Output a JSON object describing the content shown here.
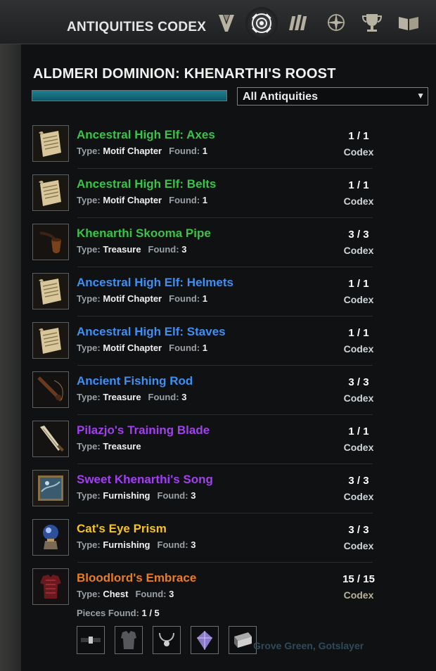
{
  "header": {
    "title": "ANTIQUITIES CODEX",
    "tabs": [
      {
        "icon": "alliance-emblem-icon",
        "active": false
      },
      {
        "icon": "antiquity-lens-icon",
        "active": true
      },
      {
        "icon": "scrolls-icon",
        "active": false
      },
      {
        "icon": "compass-star-icon",
        "active": false
      },
      {
        "icon": "trophy-icon",
        "active": false
      },
      {
        "icon": "open-book-icon",
        "active": false
      }
    ]
  },
  "zone": {
    "title": "ALDMERI DOMINION: KHENARTHI'S ROOST",
    "progress": 1.0,
    "filter": "All Antiquities"
  },
  "colors": {
    "green": "#39c34a",
    "blue": "#3f8ff2",
    "purple": "#a33ff2",
    "gold": "#f5c322",
    "orange": "#ec7c1d",
    "progress": "#1b7c8c"
  },
  "labels": {
    "type": "Type:",
    "found": "Found:",
    "codex": "Codex"
  },
  "items": [
    {
      "name": "Ancestral High Elf: Axes",
      "quality": "green",
      "type": "Motif Chapter",
      "found": "1",
      "count": "1 / 1",
      "icon": "scroll-icon"
    },
    {
      "name": "Ancestral High Elf: Belts",
      "quality": "green",
      "type": "Motif Chapter",
      "found": "1",
      "count": "1 / 1",
      "icon": "scroll-icon"
    },
    {
      "name": "Khenarthi Skooma Pipe",
      "quality": "green",
      "type": "Treasure",
      "found": "3",
      "count": "3 / 3",
      "icon": "pipe-icon"
    },
    {
      "name": "Ancestral High Elf: Helmets",
      "quality": "blue",
      "type": "Motif Chapter",
      "found": "1",
      "count": "1 / 1",
      "icon": "scroll-icon"
    },
    {
      "name": "Ancestral High Elf: Staves",
      "quality": "blue",
      "type": "Motif Chapter",
      "found": "1",
      "count": "1 / 1",
      "icon": "scroll-icon"
    },
    {
      "name": "Ancient Fishing Rod",
      "quality": "blue",
      "type": "Treasure",
      "found": "3",
      "count": "3 / 3",
      "icon": "fishing-rod-icon"
    },
    {
      "name": "Pilazjo's Training Blade",
      "quality": "purple",
      "type": "Treasure",
      "found": "",
      "count": "1 / 1",
      "icon": "blade-icon"
    },
    {
      "name": "Sweet Khenarthi's Song",
      "quality": "purple",
      "type": "Furnishing",
      "found": "3",
      "count": "3 / 3",
      "icon": "painting-icon"
    },
    {
      "name": "Cat's Eye Prism",
      "quality": "gold",
      "type": "Furnishing",
      "found": "3",
      "count": "3 / 3",
      "icon": "prism-icon"
    },
    {
      "name": "Bloodlord's Embrace",
      "quality": "orange",
      "type": "Chest",
      "found": "3",
      "count": "15 / 15",
      "icon": "armor-chest-icon"
    }
  ],
  "set_pieces": {
    "label": "Pieces Found:",
    "value": "1 / 5",
    "icons": [
      "belt-icon",
      "chest-piece-icon",
      "necklace-icon",
      "gem-icon",
      "tome-icon"
    ]
  },
  "background_text": "Grove Green, Gotslayer"
}
